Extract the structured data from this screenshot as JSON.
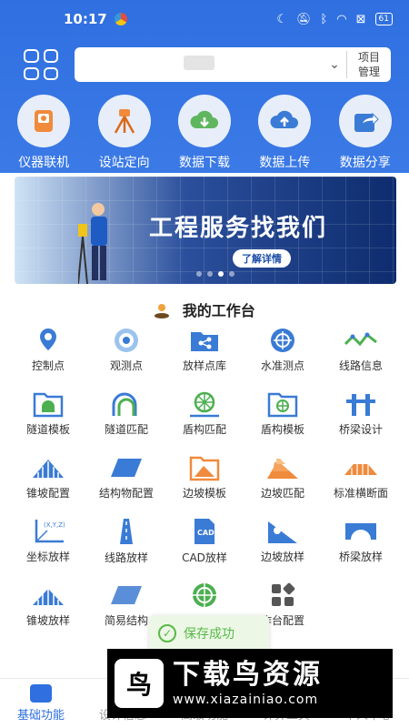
{
  "status_bar": {
    "time": "10:17",
    "battery": "61"
  },
  "project": {
    "value": "",
    "manage_label_1": "项目",
    "manage_label_2": "管理"
  },
  "quick_actions": [
    {
      "label": "仪器联机",
      "icon": "instrument-icon"
    },
    {
      "label": "设站定向",
      "icon": "tripod-icon"
    },
    {
      "label": "数据下载",
      "icon": "cloud-download-icon"
    },
    {
      "label": "数据上传",
      "icon": "cloud-upload-icon"
    },
    {
      "label": "数据分享",
      "icon": "share-icon"
    }
  ],
  "banner": {
    "title": "工程服务找我们",
    "button": "了解详情"
  },
  "workbench": {
    "title": "我的工作台"
  },
  "tools": [
    {
      "label": "控制点",
      "icon": "location-pin-icon"
    },
    {
      "label": "观测点",
      "icon": "target-icon"
    },
    {
      "label": "放样点库",
      "icon": "folder-share-icon"
    },
    {
      "label": "水准测点",
      "icon": "crosshair-icon"
    },
    {
      "label": "线路信息",
      "icon": "route-line-icon"
    },
    {
      "label": "隧道模板",
      "icon": "tunnel-folder-icon"
    },
    {
      "label": "隧道匹配",
      "icon": "tunnel-arch-icon"
    },
    {
      "label": "盾构匹配",
      "icon": "shield-machine-icon"
    },
    {
      "label": "盾构模板",
      "icon": "shield-folder-icon"
    },
    {
      "label": "桥梁设计",
      "icon": "bridge-pier-icon"
    },
    {
      "label": "锥坡配置",
      "icon": "slope-cone-icon"
    },
    {
      "label": "结构物配置",
      "icon": "parallelogram-icon"
    },
    {
      "label": "边坡模板",
      "icon": "slope-folder-icon"
    },
    {
      "label": "边坡匹配",
      "icon": "slope-layers-icon"
    },
    {
      "label": "标准横断面",
      "icon": "cross-section-icon"
    },
    {
      "label": "坐标放样",
      "icon": "xyz-axis-icon"
    },
    {
      "label": "线路放样",
      "icon": "road-icon"
    },
    {
      "label": "CAD放样",
      "icon": "cad-file-icon"
    },
    {
      "label": "边坡放样",
      "icon": "slope-stakeout-icon"
    },
    {
      "label": "桥梁放样",
      "icon": "bridge-icon"
    },
    {
      "label": "锥坡放样",
      "icon": "cone-stakeout-icon"
    },
    {
      "label": "简易结构",
      "icon": "simple-structure-icon"
    },
    {
      "label": "",
      "icon": "circle-grid-icon"
    },
    {
      "label": "作台配置",
      "icon": "apps-config-icon"
    },
    {
      "label": "",
      "icon": ""
    }
  ],
  "toast": {
    "text": "保存成功"
  },
  "tabs": [
    {
      "label": "基础功能",
      "active": true
    },
    {
      "label": "设计信息",
      "active": false
    },
    {
      "label": "高级功能",
      "active": false
    },
    {
      "label": "计算工具",
      "active": false
    },
    {
      "label": "个人中心",
      "active": false
    }
  ],
  "watermark": {
    "logo": "鸟",
    "title": "下载鸟资源",
    "url": "www.xiazainiao.com"
  },
  "colors": {
    "primary": "#2f6fe0",
    "toast_green": "#58b947",
    "icon_blue": "#3a7bd5",
    "icon_orange": "#f08a3c"
  }
}
